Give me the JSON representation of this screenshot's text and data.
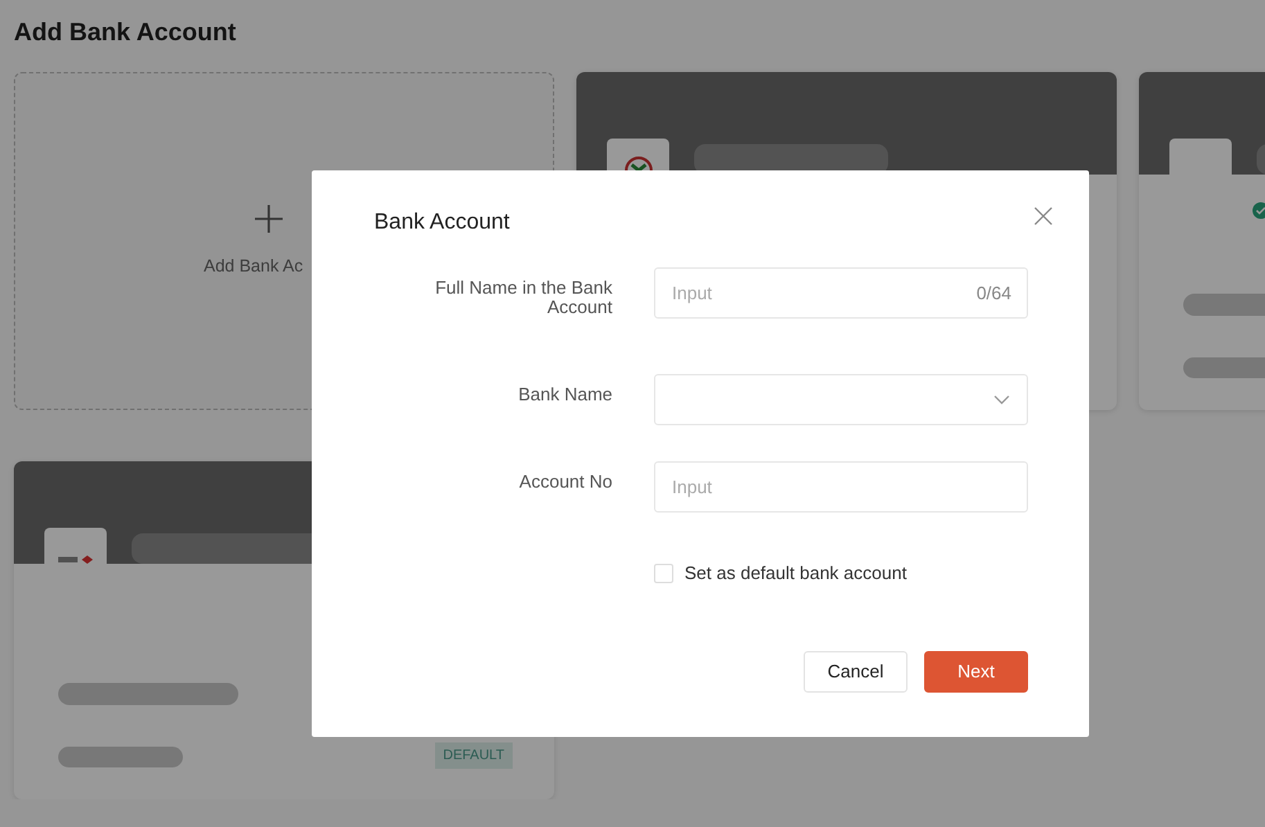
{
  "page": {
    "title": "Add Bank Account"
  },
  "add_card": {
    "label": "Add Bank Ac"
  },
  "bank_cards": [
    {
      "kind": "bank"
    },
    {
      "kind": "bank",
      "verified": true
    },
    {
      "kind": "bank",
      "badge": "DEFAULT"
    }
  ],
  "modal": {
    "title": "Bank Account",
    "fields": [
      {
        "kind": "text",
        "label": "Full Name in the Bank Account",
        "placeholder": "Input",
        "counter": "0/64"
      },
      {
        "kind": "select",
        "label": "Bank Name"
      },
      {
        "kind": "text",
        "label": "Account No",
        "placeholder": "Input"
      }
    ],
    "checkbox": {
      "label": "Set as default bank account",
      "checked": false
    },
    "buttons": [
      {
        "label": "Cancel",
        "primary": false
      },
      {
        "label": "Next",
        "primary": true
      }
    ]
  }
}
